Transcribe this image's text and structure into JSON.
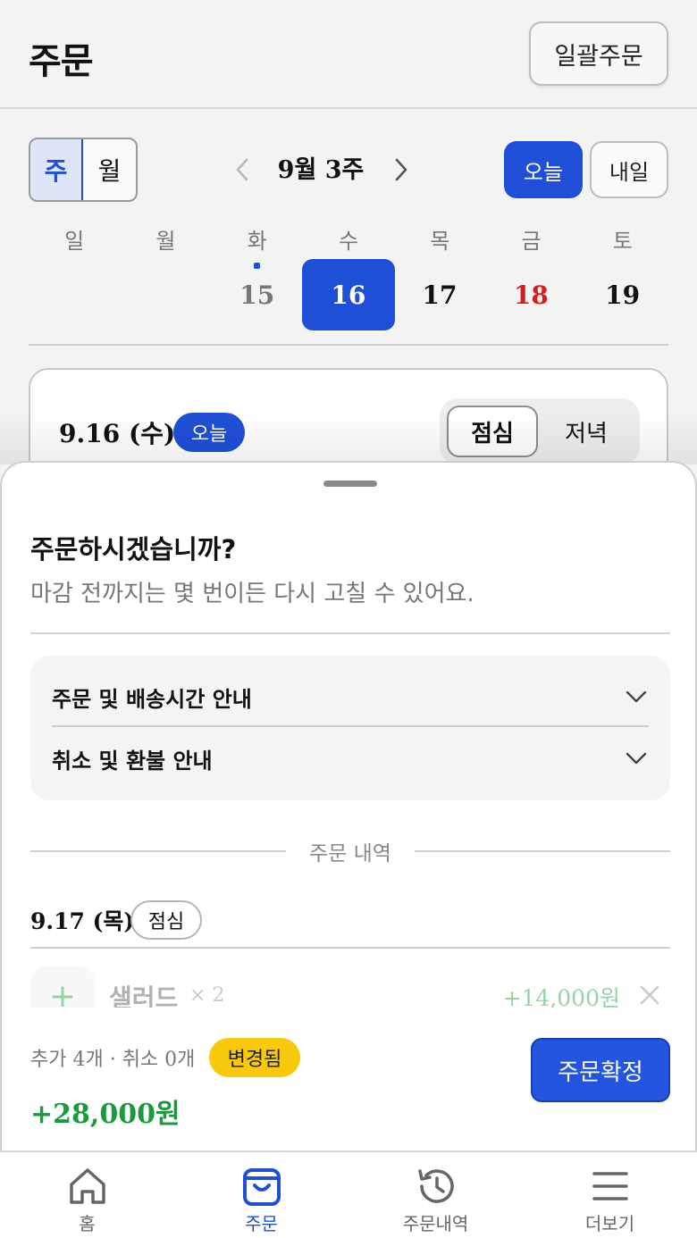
{
  "header": {
    "title": "주문",
    "bulk_order_label": "일괄주문"
  },
  "calendar": {
    "view_toggle": {
      "week": "주",
      "month": "월"
    },
    "week_label": "9월 3주",
    "today_label": "오늘",
    "tomorrow_label": "내일",
    "days_of_week": [
      "일",
      "월",
      "화",
      "수",
      "목",
      "금",
      "토"
    ],
    "dates": [
      "",
      "",
      "15",
      "16",
      "17",
      "18",
      "19"
    ],
    "selected_date": "16"
  },
  "day_card": {
    "date": "9.16 (수)",
    "today_badge": "오늘",
    "meal_lunch": "점심",
    "meal_dinner": "저녁"
  },
  "sheet": {
    "title": "주문하시겠습니까?",
    "subtitle": "마감 전까지는 몇 번이든 다시 고칠 수 있어요.",
    "info_items": [
      {
        "label": "주문 및 배송시간 안내"
      },
      {
        "label": "취소 및 환불 안내"
      }
    ],
    "history_label": "주문 내역",
    "order": {
      "date": "9.17 (목)",
      "meal": "점심",
      "item_icon": "+",
      "item_name": "샐러드",
      "item_qty": "× 2",
      "item_price": "+14,000원"
    },
    "footer": {
      "summary": "추가 4개 · 취소 0개",
      "changed_badge": "변경됨",
      "total": "+28,000원",
      "confirm_label": "주문확정"
    }
  },
  "tabbar": {
    "tabs": [
      {
        "label": "홈",
        "icon": "home-icon"
      },
      {
        "label": "주문",
        "icon": "shopping-bag-icon",
        "active": true
      },
      {
        "label": "주문내역",
        "icon": "history-icon"
      },
      {
        "label": "더보기",
        "icon": "menu-icon"
      }
    ]
  },
  "colors": {
    "primary": "#1f4fd6",
    "positive": "#1a9a3c",
    "weekend_friday": "#d61e1e",
    "badge_yellow": "#f8c80c"
  }
}
